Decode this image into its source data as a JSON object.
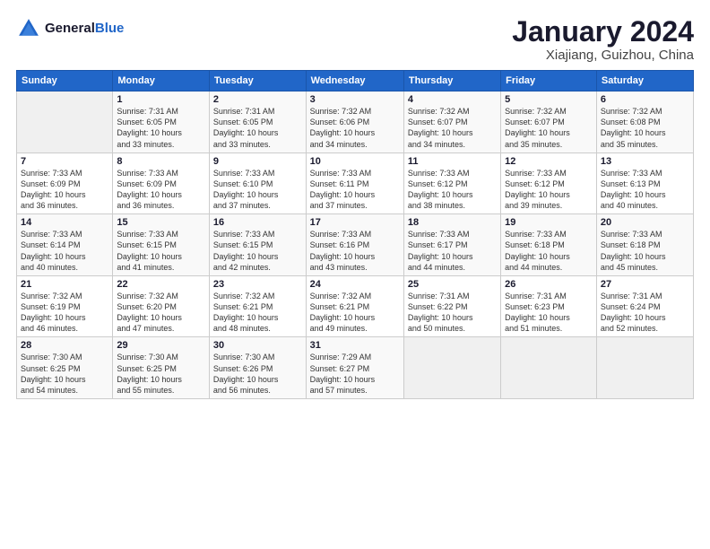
{
  "logo": {
    "text_general": "General",
    "text_blue": "Blue"
  },
  "title": "January 2024",
  "subtitle": "Xiajiang, Guizhou, China",
  "days_of_week": [
    "Sunday",
    "Monday",
    "Tuesday",
    "Wednesday",
    "Thursday",
    "Friday",
    "Saturday"
  ],
  "weeks": [
    [
      {
        "day": "",
        "info": ""
      },
      {
        "day": "1",
        "info": "Sunrise: 7:31 AM\nSunset: 6:05 PM\nDaylight: 10 hours\nand 33 minutes."
      },
      {
        "day": "2",
        "info": "Sunrise: 7:31 AM\nSunset: 6:05 PM\nDaylight: 10 hours\nand 33 minutes."
      },
      {
        "day": "3",
        "info": "Sunrise: 7:32 AM\nSunset: 6:06 PM\nDaylight: 10 hours\nand 34 minutes."
      },
      {
        "day": "4",
        "info": "Sunrise: 7:32 AM\nSunset: 6:07 PM\nDaylight: 10 hours\nand 34 minutes."
      },
      {
        "day": "5",
        "info": "Sunrise: 7:32 AM\nSunset: 6:07 PM\nDaylight: 10 hours\nand 35 minutes."
      },
      {
        "day": "6",
        "info": "Sunrise: 7:32 AM\nSunset: 6:08 PM\nDaylight: 10 hours\nand 35 minutes."
      }
    ],
    [
      {
        "day": "7",
        "info": "Sunrise: 7:33 AM\nSunset: 6:09 PM\nDaylight: 10 hours\nand 36 minutes."
      },
      {
        "day": "8",
        "info": "Sunrise: 7:33 AM\nSunset: 6:09 PM\nDaylight: 10 hours\nand 36 minutes."
      },
      {
        "day": "9",
        "info": "Sunrise: 7:33 AM\nSunset: 6:10 PM\nDaylight: 10 hours\nand 37 minutes."
      },
      {
        "day": "10",
        "info": "Sunrise: 7:33 AM\nSunset: 6:11 PM\nDaylight: 10 hours\nand 37 minutes."
      },
      {
        "day": "11",
        "info": "Sunrise: 7:33 AM\nSunset: 6:12 PM\nDaylight: 10 hours\nand 38 minutes."
      },
      {
        "day": "12",
        "info": "Sunrise: 7:33 AM\nSunset: 6:12 PM\nDaylight: 10 hours\nand 39 minutes."
      },
      {
        "day": "13",
        "info": "Sunrise: 7:33 AM\nSunset: 6:13 PM\nDaylight: 10 hours\nand 40 minutes."
      }
    ],
    [
      {
        "day": "14",
        "info": "Sunrise: 7:33 AM\nSunset: 6:14 PM\nDaylight: 10 hours\nand 40 minutes."
      },
      {
        "day": "15",
        "info": "Sunrise: 7:33 AM\nSunset: 6:15 PM\nDaylight: 10 hours\nand 41 minutes."
      },
      {
        "day": "16",
        "info": "Sunrise: 7:33 AM\nSunset: 6:15 PM\nDaylight: 10 hours\nand 42 minutes."
      },
      {
        "day": "17",
        "info": "Sunrise: 7:33 AM\nSunset: 6:16 PM\nDaylight: 10 hours\nand 43 minutes."
      },
      {
        "day": "18",
        "info": "Sunrise: 7:33 AM\nSunset: 6:17 PM\nDaylight: 10 hours\nand 44 minutes."
      },
      {
        "day": "19",
        "info": "Sunrise: 7:33 AM\nSunset: 6:18 PM\nDaylight: 10 hours\nand 44 minutes."
      },
      {
        "day": "20",
        "info": "Sunrise: 7:33 AM\nSunset: 6:18 PM\nDaylight: 10 hours\nand 45 minutes."
      }
    ],
    [
      {
        "day": "21",
        "info": "Sunrise: 7:32 AM\nSunset: 6:19 PM\nDaylight: 10 hours\nand 46 minutes."
      },
      {
        "day": "22",
        "info": "Sunrise: 7:32 AM\nSunset: 6:20 PM\nDaylight: 10 hours\nand 47 minutes."
      },
      {
        "day": "23",
        "info": "Sunrise: 7:32 AM\nSunset: 6:21 PM\nDaylight: 10 hours\nand 48 minutes."
      },
      {
        "day": "24",
        "info": "Sunrise: 7:32 AM\nSunset: 6:21 PM\nDaylight: 10 hours\nand 49 minutes."
      },
      {
        "day": "25",
        "info": "Sunrise: 7:31 AM\nSunset: 6:22 PM\nDaylight: 10 hours\nand 50 minutes."
      },
      {
        "day": "26",
        "info": "Sunrise: 7:31 AM\nSunset: 6:23 PM\nDaylight: 10 hours\nand 51 minutes."
      },
      {
        "day": "27",
        "info": "Sunrise: 7:31 AM\nSunset: 6:24 PM\nDaylight: 10 hours\nand 52 minutes."
      }
    ],
    [
      {
        "day": "28",
        "info": "Sunrise: 7:30 AM\nSunset: 6:25 PM\nDaylight: 10 hours\nand 54 minutes."
      },
      {
        "day": "29",
        "info": "Sunrise: 7:30 AM\nSunset: 6:25 PM\nDaylight: 10 hours\nand 55 minutes."
      },
      {
        "day": "30",
        "info": "Sunrise: 7:30 AM\nSunset: 6:26 PM\nDaylight: 10 hours\nand 56 minutes."
      },
      {
        "day": "31",
        "info": "Sunrise: 7:29 AM\nSunset: 6:27 PM\nDaylight: 10 hours\nand 57 minutes."
      },
      {
        "day": "",
        "info": ""
      },
      {
        "day": "",
        "info": ""
      },
      {
        "day": "",
        "info": ""
      }
    ]
  ]
}
